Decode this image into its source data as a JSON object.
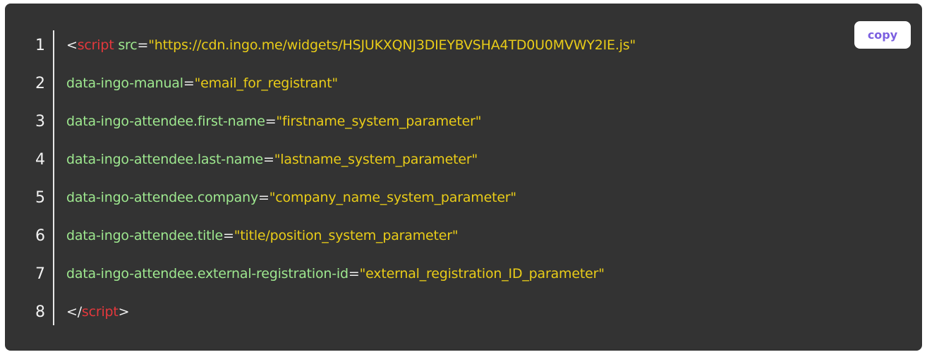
{
  "copy_button": {
    "label": "copy"
  },
  "colors": {
    "background": "#333333",
    "tag": "#e4383c",
    "attribute": "#9ee88f",
    "string": "#e9cc18",
    "punctuation": "#f2f2f2",
    "copy_text": "#7b5fe0"
  },
  "lines": [
    {
      "number": "1",
      "open": "<",
      "tag": "script",
      "space": " ",
      "attr": "src",
      "eq": "=",
      "value": "\"https://cdn.ingo.me/widgets/HSJUKXQNJ3DIEYBVSHA4TD0U0MVWY2IE.js\""
    },
    {
      "number": "2",
      "attr": "data-ingo-manual",
      "eq": "=",
      "value": "\"email_for_registrant\""
    },
    {
      "number": "3",
      "attr": "data-ingo-attendee.first-name",
      "eq": "=",
      "value": "\"firstname_system_parameter\""
    },
    {
      "number": "4",
      "attr": "data-ingo-attendee.last-name",
      "eq": "=",
      "value": "\"lastname_system_parameter\""
    },
    {
      "number": "5",
      "attr": "data-ingo-attendee.company",
      "eq": "=",
      "value": "\"company_name_system_parameter\""
    },
    {
      "number": "6",
      "attr": "data-ingo-attendee.title",
      "eq": "=",
      "value": "\"title/position_system_parameter\""
    },
    {
      "number": "7",
      "attr": "data-ingo-attendee.external-registration-id",
      "eq": "=",
      "value": "\"external_registration_ID_parameter\""
    },
    {
      "number": "8",
      "open": "</",
      "tag": "script",
      "close": ">"
    }
  ]
}
